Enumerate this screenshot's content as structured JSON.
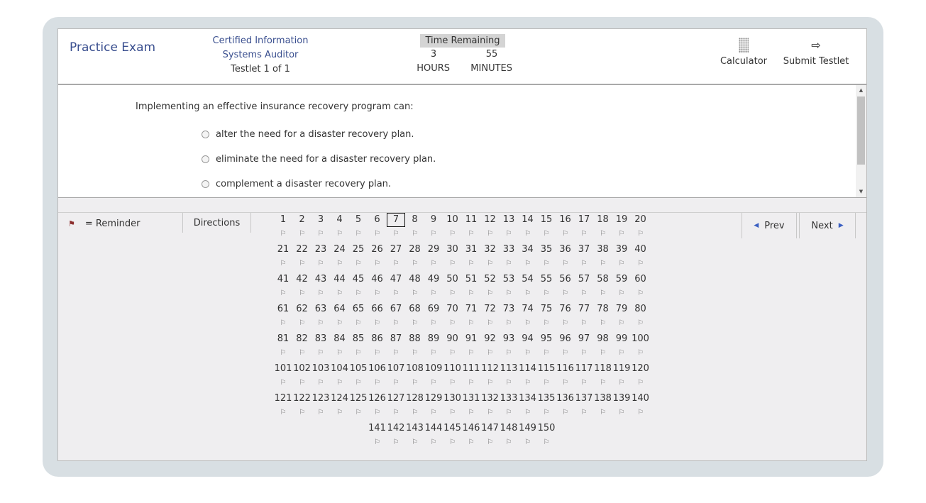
{
  "header": {
    "title": "Practice Exam",
    "exam_line1": "Certified Information",
    "exam_line2": "Systems Auditor",
    "testlet": "Testlet 1 of 1",
    "timer_label": "Time Remaining",
    "hours_value": "3",
    "minutes_value": "55",
    "hours_label": "HOURS",
    "minutes_label": "MINUTES",
    "calculator_label": "Calculator",
    "submit_label": "Submit Testlet"
  },
  "question": {
    "stem": "Implementing an effective insurance recovery program can:",
    "options": [
      "alter the need for a disaster recovery plan.",
      "eliminate the need for a disaster recovery plan.",
      "complement a disaster recovery plan."
    ]
  },
  "navigation": {
    "reminder_label": "= Reminder",
    "directions_label": "Directions",
    "prev_label": "Prev",
    "next_label": "Next",
    "total_questions": 150,
    "current_question": 7
  },
  "icons": {
    "reminder": "flag-icon",
    "calculator": "calculator-icon",
    "submit": "arrow-right-icon",
    "prev": "triangle-left-icon",
    "next": "triangle-right-icon",
    "question_flag": "flag-outline-icon"
  },
  "colors": {
    "accent": "#3a4f8f",
    "reminder_flag": "#8b2d2d",
    "nav_arrow": "#3a5fc2"
  }
}
